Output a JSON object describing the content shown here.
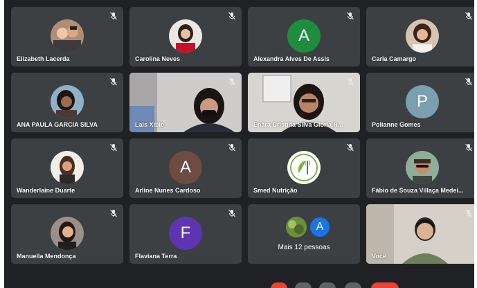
{
  "participants": [
    {
      "name": "Elizabeth Lacerda",
      "type": "photo",
      "muted": true
    },
    {
      "name": "Carolina Neves",
      "type": "photo",
      "muted": true
    },
    {
      "name": "Alexandra Alves De Assis",
      "type": "letter",
      "letter": "A",
      "color": "#1e8e3e",
      "muted": true
    },
    {
      "name": "Carla Camargo",
      "type": "photo",
      "muted": true
    },
    {
      "name": "ANA PAULA GARCIA SILVA",
      "type": "photo",
      "muted": true
    },
    {
      "name": "Lais Xible",
      "type": "video",
      "muted": true
    },
    {
      "name": "Enara Cristina Silva Gloria R...",
      "type": "video",
      "muted": true
    },
    {
      "name": "Polianne Gomes",
      "type": "letter",
      "letter": "P",
      "color": "#7b9eb0",
      "muted": true
    },
    {
      "name": "Wanderlaine Duarte",
      "type": "photo",
      "muted": true
    },
    {
      "name": "Arline Nunes Cardoso",
      "type": "letter",
      "letter": "A",
      "color": "#6d4c41",
      "muted": true
    },
    {
      "name": "Smed Nutrição",
      "type": "logo",
      "muted": true
    },
    {
      "name": "Fábio de Souza Villaça Medei...",
      "type": "photo",
      "muted": true
    },
    {
      "name": "Manuella Mendonça",
      "type": "photo",
      "muted": true
    },
    {
      "name": "Flaviana Terra",
      "type": "letter",
      "letter": "F",
      "color": "#5e35b1",
      "muted": true
    },
    {
      "name": "Você",
      "type": "video",
      "muted": true
    }
  ],
  "overflow": {
    "label": "Mais 12 pessoas",
    "letter": "A",
    "color": "#1a73e8"
  },
  "icons": {
    "mic_off": "mic-off-icon"
  }
}
